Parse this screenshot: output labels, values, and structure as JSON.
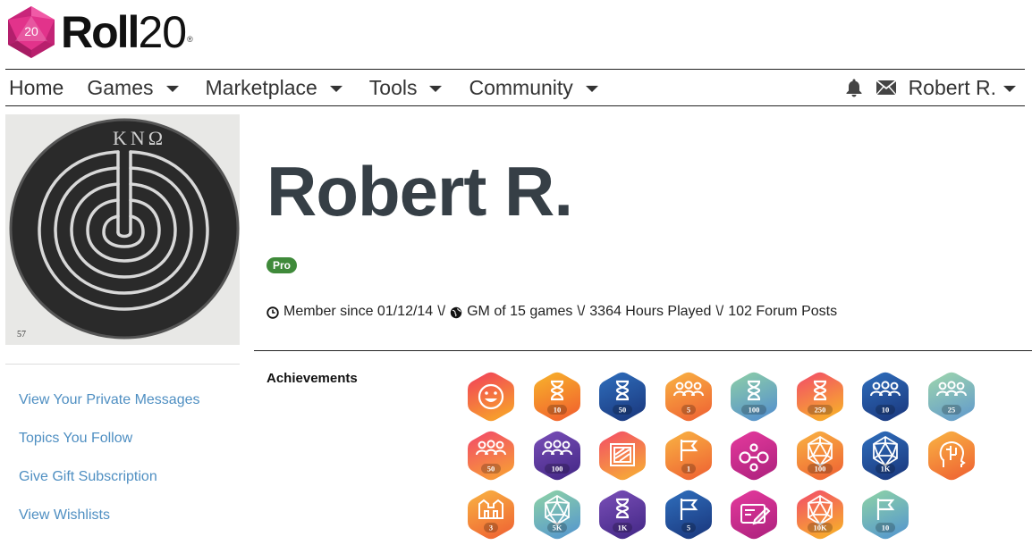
{
  "brand": {
    "name": "Roll",
    "number": "20",
    "die_number": "20",
    "registered": "®"
  },
  "nav": {
    "items": [
      {
        "label": "Home",
        "dropdown": false
      },
      {
        "label": "Games",
        "dropdown": true
      },
      {
        "label": "Marketplace",
        "dropdown": true
      },
      {
        "label": "Tools",
        "dropdown": true
      },
      {
        "label": "Community",
        "dropdown": true
      }
    ],
    "user_label": "Robert R."
  },
  "avatar": {
    "caption": "57",
    "inscription": "ΚΝΩ"
  },
  "sidebar": {
    "links": [
      {
        "label": "View Your Private Messages"
      },
      {
        "label": "Topics You Follow"
      },
      {
        "label": "Give Gift Subscription"
      },
      {
        "label": "View Wishlists"
      }
    ]
  },
  "profile": {
    "name": "Robert R.",
    "badge": "Pro",
    "member_since": "Member since 01/12/14",
    "gm_of": "GM of 15 games",
    "hours": "3364 Hours Played",
    "forum_posts": "102 Forum Posts",
    "separator": "\\/"
  },
  "achievements": {
    "label": "Achievements",
    "items": [
      {
        "icon": "smiley-icon",
        "count": "",
        "colors": [
          "#f13d5c",
          "#f79b2e"
        ]
      },
      {
        "icon": "hourglass-icon",
        "count": "10",
        "colors": [
          "#f7b52c",
          "#f26a2d"
        ]
      },
      {
        "icon": "hourglass-icon",
        "count": "50",
        "colors": [
          "#2f6fbd",
          "#1d3f86"
        ]
      },
      {
        "icon": "group-icon",
        "count": "5",
        "colors": [
          "#f9b443",
          "#f06d35"
        ]
      },
      {
        "icon": "hourglass-icon",
        "count": "100",
        "colors": [
          "#8fd0a6",
          "#5b97c9"
        ]
      },
      {
        "icon": "hourglass-icon",
        "count": "250",
        "colors": [
          "#f24a6a",
          "#f7a630"
        ]
      },
      {
        "icon": "group-icon",
        "count": "10",
        "colors": [
          "#2f6fbd",
          "#1d3f86"
        ]
      },
      {
        "icon": "group-icon",
        "count": "25",
        "colors": [
          "#9fd7ac",
          "#6aa2c8"
        ]
      },
      {
        "icon": "group-icon",
        "count": "50",
        "colors": [
          "#f2476b",
          "#f7963a"
        ]
      },
      {
        "icon": "group-icon",
        "count": "100",
        "colors": [
          "#7a4fb8",
          "#4b2d8d"
        ]
      },
      {
        "icon": "board-icon",
        "count": "",
        "colors": [
          "#f34b68",
          "#f6a23b"
        ]
      },
      {
        "icon": "flag-icon",
        "count": "1",
        "colors": [
          "#f9b443",
          "#f06d35"
        ]
      },
      {
        "icon": "infinity-icon",
        "count": "",
        "colors": [
          "#e53a9d",
          "#b52582"
        ]
      },
      {
        "icon": "d20-icon",
        "count": "100",
        "colors": [
          "#f9b443",
          "#f06d35"
        ]
      },
      {
        "icon": "d20-icon",
        "count": "1K",
        "colors": [
          "#2f6fbd",
          "#1d3f86"
        ]
      },
      {
        "icon": "head-icon",
        "count": "",
        "colors": [
          "#f9b443",
          "#f06d35"
        ]
      },
      {
        "icon": "castle-icon",
        "count": "3",
        "colors": [
          "#f9b443",
          "#f06d35"
        ]
      },
      {
        "icon": "d20-icon",
        "count": "5K",
        "colors": [
          "#8fd4a5",
          "#5c9ec9"
        ]
      },
      {
        "icon": "hourglass-icon",
        "count": "1K",
        "colors": [
          "#7a4fb8",
          "#4b2d8d"
        ]
      },
      {
        "icon": "flag-icon",
        "count": "5",
        "colors": [
          "#2f6fbd",
          "#1d3f86"
        ]
      },
      {
        "icon": "pencil-icon",
        "count": "",
        "colors": [
          "#e53a9d",
          "#b52582"
        ]
      },
      {
        "icon": "d20-icon",
        "count": "10K",
        "colors": [
          "#f24a6a",
          "#f7a630"
        ]
      },
      {
        "icon": "flag-icon",
        "count": "10",
        "colors": [
          "#8fd4a5",
          "#5c9ec9"
        ]
      }
    ]
  }
}
